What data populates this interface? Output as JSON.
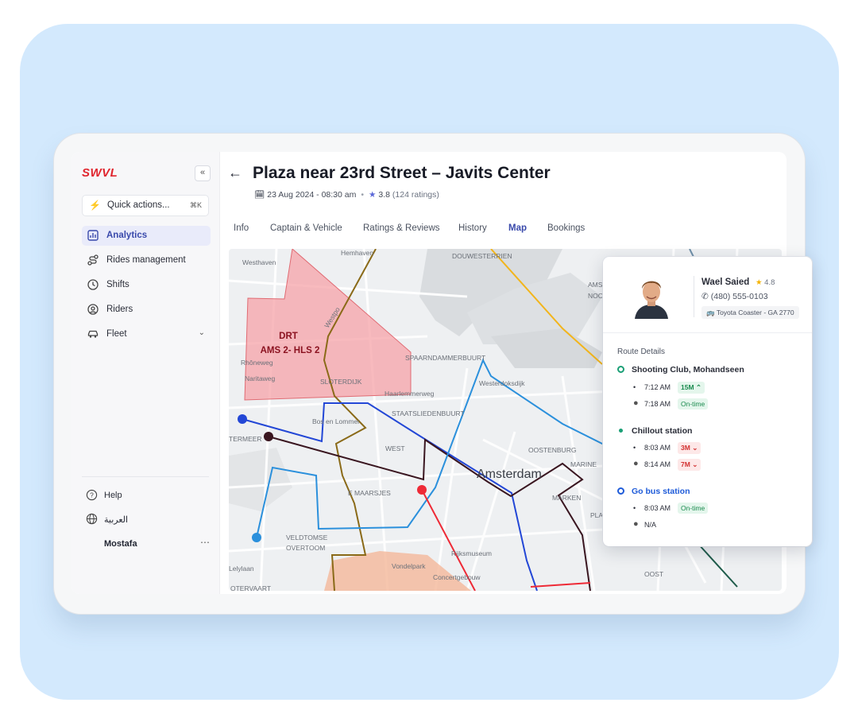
{
  "app": {
    "logo": "SWVL"
  },
  "sidebar": {
    "quick_actions": {
      "label": "Quick actions...",
      "shortcut": "⌘K"
    },
    "items": [
      {
        "label": "Analytics",
        "active": true,
        "icon": "chart-icon"
      },
      {
        "label": "Rides management",
        "icon": "route-icon"
      },
      {
        "label": "Shifts",
        "icon": "clock-icon"
      },
      {
        "label": "Riders",
        "icon": "user-icon"
      },
      {
        "label": "Fleet",
        "icon": "car-icon"
      }
    ],
    "bottom": {
      "help": "Help",
      "language": "العربية",
      "user": "Mostafa"
    }
  },
  "header": {
    "title": "Plaza near 23rd Street – Javits Center",
    "date": "23 Aug 2024 - 08:30 am",
    "rating": "3.8",
    "rating_count": "(124 ratings)"
  },
  "tabs": [
    "Info",
    "Captain & Vehicle",
    "Ratings & Reviews",
    "History",
    "Map",
    "Bookings"
  ],
  "active_tab": "Map",
  "map": {
    "zone_label_1": "DRT",
    "zone_label_2": "AMS 2- HLS 2",
    "labels": {
      "westhaven": "Westhaven",
      "hemhaven": "Hemhaven",
      "douwes": "DOUWESTERRIEN",
      "amster": "AMSTER",
      "noord": "NOO",
      "rhoneweg": "Rhôneweg",
      "naritaweg": "Naritaweg",
      "sloterdijk": "SLOTERDIJK",
      "spaarn": "SPAARNDAMMERBUURT",
      "westerdok": "Westerdoksdijk",
      "haarlem": "Haarlemmerweg",
      "staats": "STAATSLIEDENBUURT",
      "bosleeuw": "Bos en Lommer",
      "termeer": "TERMEER",
      "west": "WEST",
      "amsterdam": "Amsterdam",
      "oostenburg": "OOSTENBURG",
      "marine": "MARINE",
      "marken": "MARKEN",
      "plantage": "PLANTA",
      "jordaan": "E MAARSJES",
      "veldt": "VELDTOMSE",
      "overtoom": "OVERTOOM",
      "rijks": "Rijksmuseum",
      "vondel": "Vondelpark",
      "concert": "Concertgebouw",
      "leilaan": "Lelylaan",
      "oost": "OOST",
      "westhafen": "Westhaven",
      "oetervaart": "OTERVAART",
      "westpoint": "Westpo",
      "wester": "Wester"
    }
  },
  "captain": {
    "name": "Wael Saied",
    "rating": "4.8",
    "phone": "(480) 555-0103",
    "vehicle": "Toyota Coaster - GA 2770"
  },
  "route": {
    "title": "Route Details",
    "stops": [
      {
        "name": "Shooting Club, Mohandseen",
        "planned": "7:12 AM",
        "delta": "15M",
        "delta_dir": "up",
        "actual": "7:18 AM",
        "status": "On-time"
      },
      {
        "name": "Chillout station",
        "planned": "8:03 AM",
        "delta": "3M",
        "delta_dir": "down",
        "actual": "8:14 AM",
        "delta2": "7M"
      },
      {
        "name": "Go bus station",
        "planned": "8:03 AM",
        "status": "On-time",
        "actual": "N/A"
      }
    ]
  },
  "colors": {
    "accent": "#3949ab",
    "brand": "#e0252e",
    "zone_fill": "#f5a3a8",
    "orange_zone": "#f4b89a"
  }
}
